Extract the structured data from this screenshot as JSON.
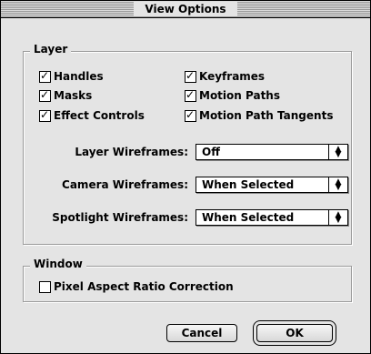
{
  "window": {
    "title": "View Options"
  },
  "layer": {
    "title": "Layer",
    "checks": [
      {
        "label": "Handles",
        "checked": true
      },
      {
        "label": "Keyframes",
        "checked": true
      },
      {
        "label": "Masks",
        "checked": true
      },
      {
        "label": "Motion Paths",
        "checked": true
      },
      {
        "label": "Effect Controls",
        "checked": true
      },
      {
        "label": "Motion Path Tangents",
        "checked": true
      }
    ],
    "layer_wireframes_label": "Layer Wireframes:",
    "layer_wireframes_value": "Off",
    "camera_wireframes_label": "Camera Wireframes:",
    "camera_wireframes_value": "When Selected",
    "spotlight_wireframes_label": "Spotlight Wireframes:",
    "spotlight_wireframes_value": "When Selected"
  },
  "window_group": {
    "title": "Window",
    "pixel_aspect_label": "Pixel Aspect Ratio Correction",
    "pixel_aspect_checked": false
  },
  "buttons": {
    "cancel": "Cancel",
    "ok": "OK"
  }
}
